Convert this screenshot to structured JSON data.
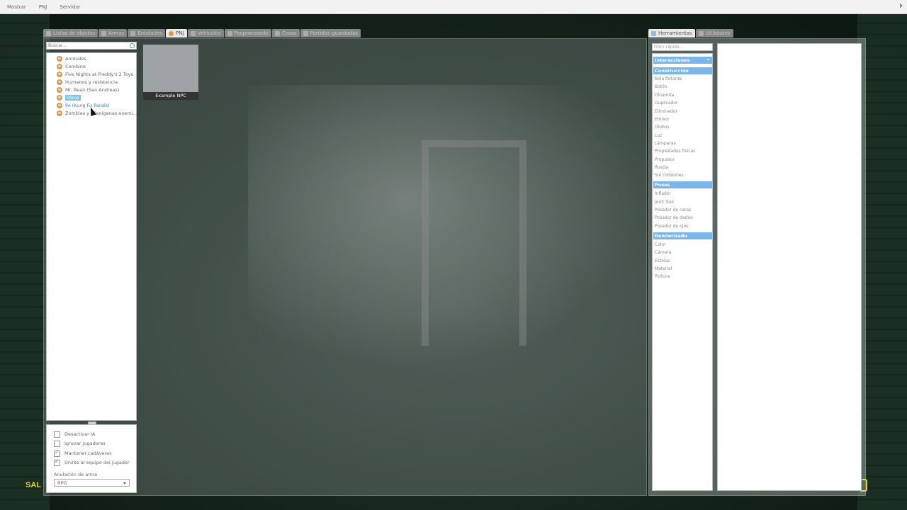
{
  "menubar": {
    "items": [
      "Mostrar",
      "PNJ",
      "Servidor"
    ]
  },
  "spawn_tabs": [
    {
      "label": "Listas de objetos",
      "icon": "list-icon"
    },
    {
      "label": "Armas",
      "icon": "gun-icon"
    },
    {
      "label": "Entidades",
      "icon": "entity-icon"
    },
    {
      "label": "PNJ",
      "icon": "npc-icon"
    },
    {
      "label": "Vehículos",
      "icon": "car-icon"
    },
    {
      "label": "Posprocesado",
      "icon": "postprocess-icon"
    },
    {
      "label": "Cosas",
      "icon": "dupes-icon"
    },
    {
      "label": "Partidas guardadas",
      "icon": "save-icon"
    }
  ],
  "search": {
    "placeholder": "Buscar..."
  },
  "npc_categories": [
    "Animales",
    "Combine",
    "Five Nights at Freddy's 2 Toys",
    "Humanos y resistencia",
    "Mr. Bean (San Andreas)",
    "Otros",
    "Po (Kung Fu Panda)",
    "Zombies y alienígenas enemi..."
  ],
  "selected_category": "Otros",
  "npc_card": {
    "name": "Example NPC"
  },
  "options": {
    "disable_ai": "Desactivar IA",
    "ignore_players": "Ignorar jugadores",
    "keep_corpses": "Mantener cadáveres",
    "join_player_team": "Unirse al equipo del jugador",
    "weapon_override_label": "Anulación de arma",
    "weapon_override_value": "RPG"
  },
  "option_states": {
    "disable_ai": false,
    "ignore_players": false,
    "keep_corpses": true,
    "join_player_team": true
  },
  "tool_tabs": [
    {
      "label": "Herramientas",
      "icon": "wrench-icon"
    },
    {
      "label": "Utilidades",
      "icon": "utilities-icon"
    }
  ],
  "tool_filter": {
    "placeholder": "Filtro rápido..."
  },
  "tool_list": {
    "interacciones": "Interacciones",
    "construccion": "Construcción",
    "construccion_items": [
      "Bola flotante",
      "Botón",
      "Dinamita",
      "Duplicador",
      "Eliminador",
      "Emisor",
      "Globos",
      "Luz",
      "Lámparas",
      "Propiedades físicas",
      "Propulsor",
      "Rueda",
      "Sin colisiones"
    ],
    "poses": "Poses",
    "poses_items": [
      "Inflador",
      "Joint Tool",
      "Posador de caras",
      "Posador de dedos",
      "Posador de ojos"
    ],
    "renderizado": "Renderizado",
    "renderizado_items": [
      "Color",
      "Cámara",
      "Estelas",
      "Material",
      "Pintura"
    ]
  },
  "hud": {
    "left_text": "SAL"
  }
}
